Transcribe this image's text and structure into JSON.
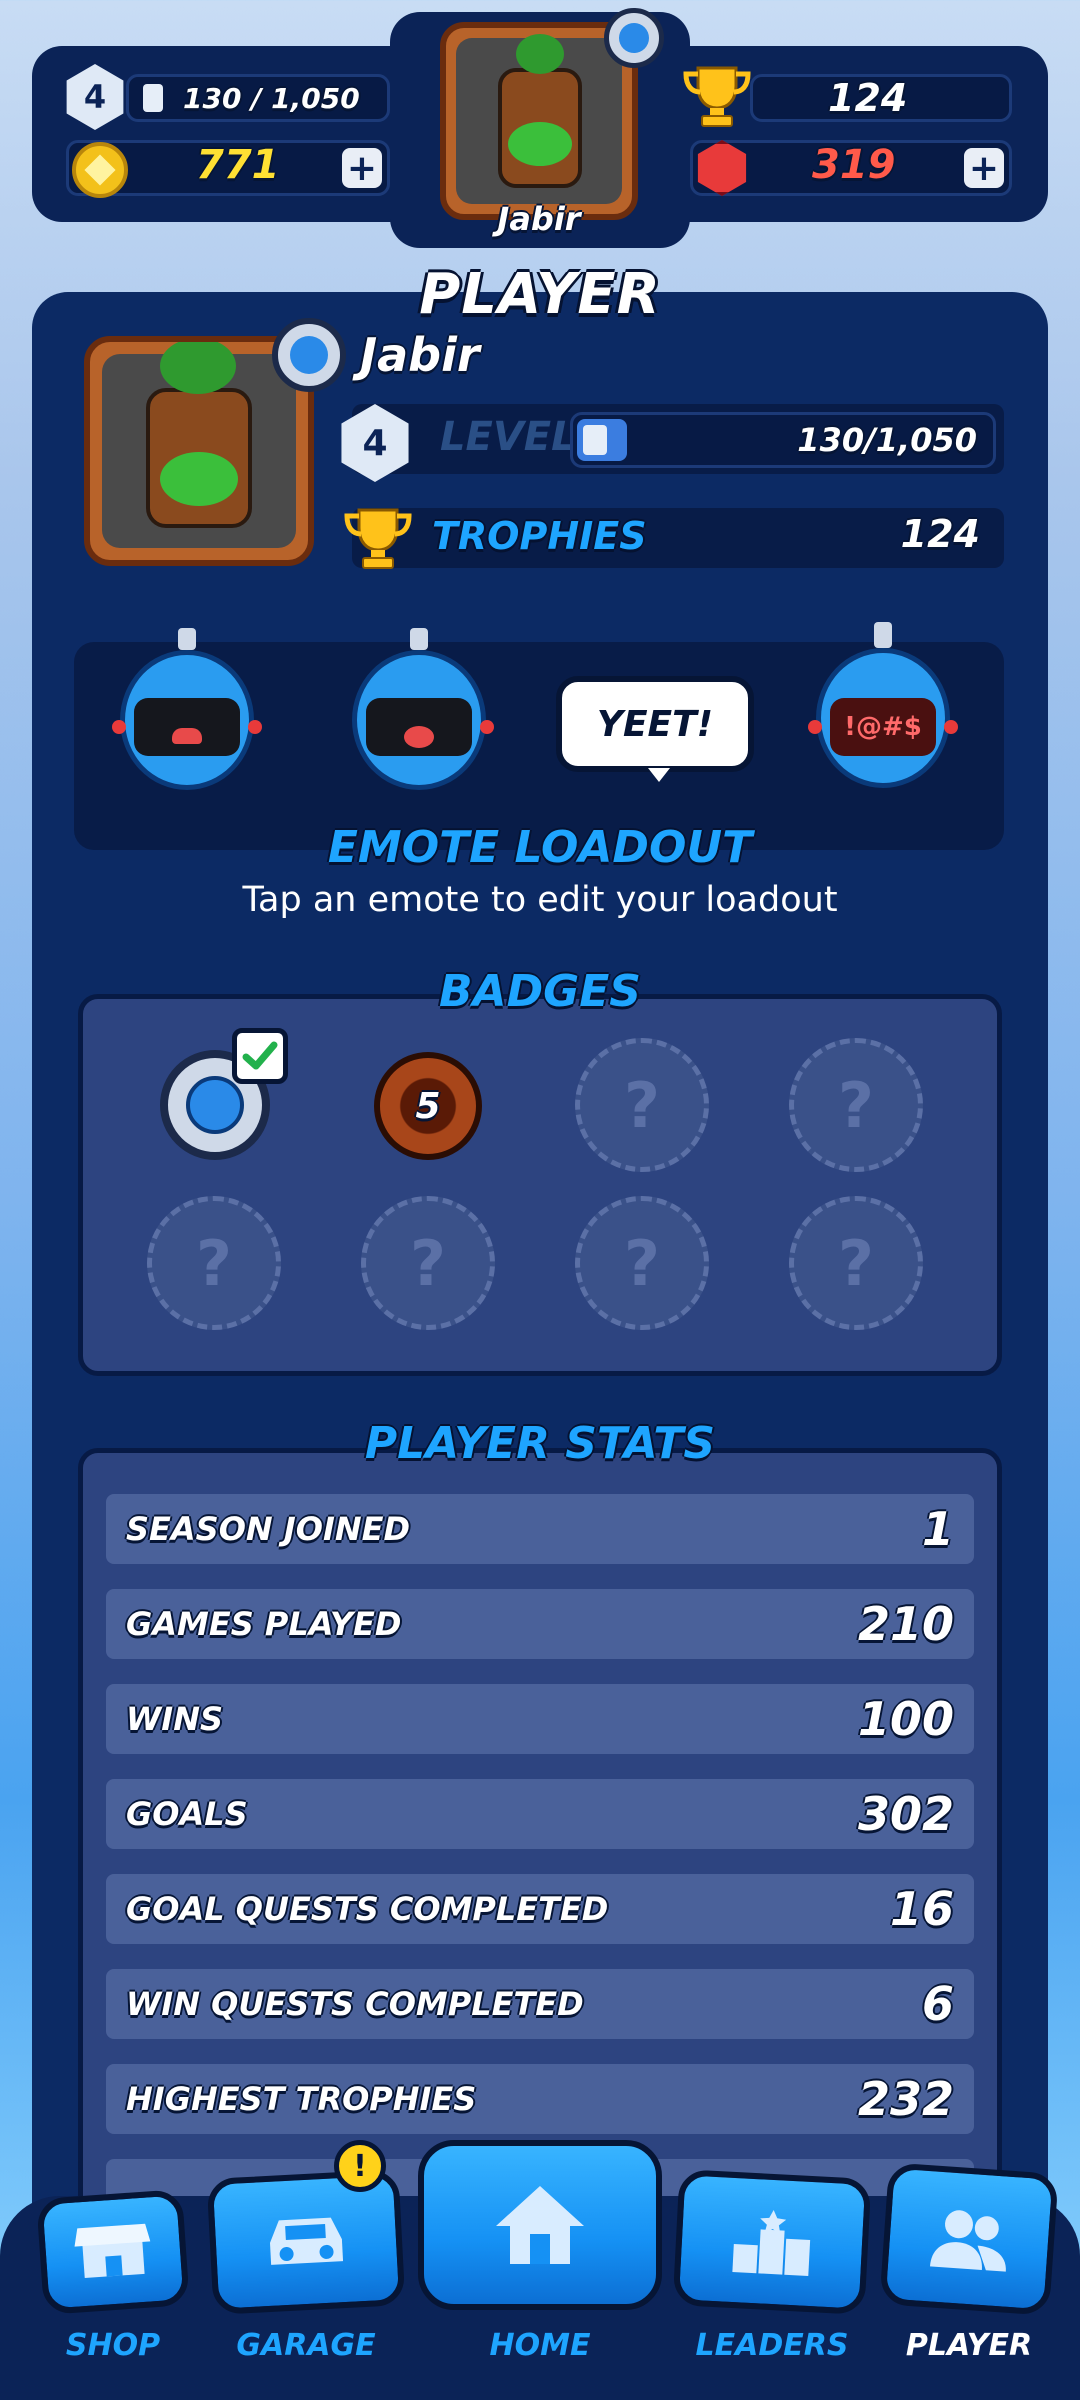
{
  "header": {
    "level": "4",
    "xp": "130 / 1,050",
    "gold": "771",
    "trophies": "124",
    "gems": "319",
    "name": "Jabir",
    "plus": "+"
  },
  "page": {
    "title": "PLAYER"
  },
  "profile": {
    "name": "Jabir",
    "level": "4",
    "level_label": "LEVEL",
    "xp": "130/1,050",
    "xp_fraction": 0.124,
    "trophies_label": "TROPHIES",
    "trophies": "124"
  },
  "emotes": {
    "bubble": "YEET!",
    "screen_text": "!@#$",
    "title": "EMOTE LOADOUT",
    "hint": "Tap an emote to edit your loadout"
  },
  "badges": {
    "title": "BADGES",
    "earned_level": "5",
    "placeholder": "?"
  },
  "stats": {
    "title": "PLAYER STATS",
    "rows": [
      {
        "label": "SEASON JOINED",
        "value": "1"
      },
      {
        "label": "GAMES PLAYED",
        "value": "210"
      },
      {
        "label": "WINS",
        "value": "100"
      },
      {
        "label": "GOALS",
        "value": "302"
      },
      {
        "label": "GOAL QUESTS COMPLETED",
        "value": "16"
      },
      {
        "label": "WIN QUESTS COMPLETED",
        "value": "6"
      },
      {
        "label": "HIGHEST TROPHIES",
        "value": "232"
      }
    ]
  },
  "nav": {
    "shop": "SHOP",
    "garage": "GARAGE",
    "garage_alert": "!",
    "home": "HOME",
    "leaders": "LEADERS",
    "player": "PLAYER"
  },
  "colors": {
    "panel": "#0c2a64",
    "accent_blue": "#1ea5ff",
    "gold": "#ffe033",
    "gem_red": "#ff5a4a"
  }
}
